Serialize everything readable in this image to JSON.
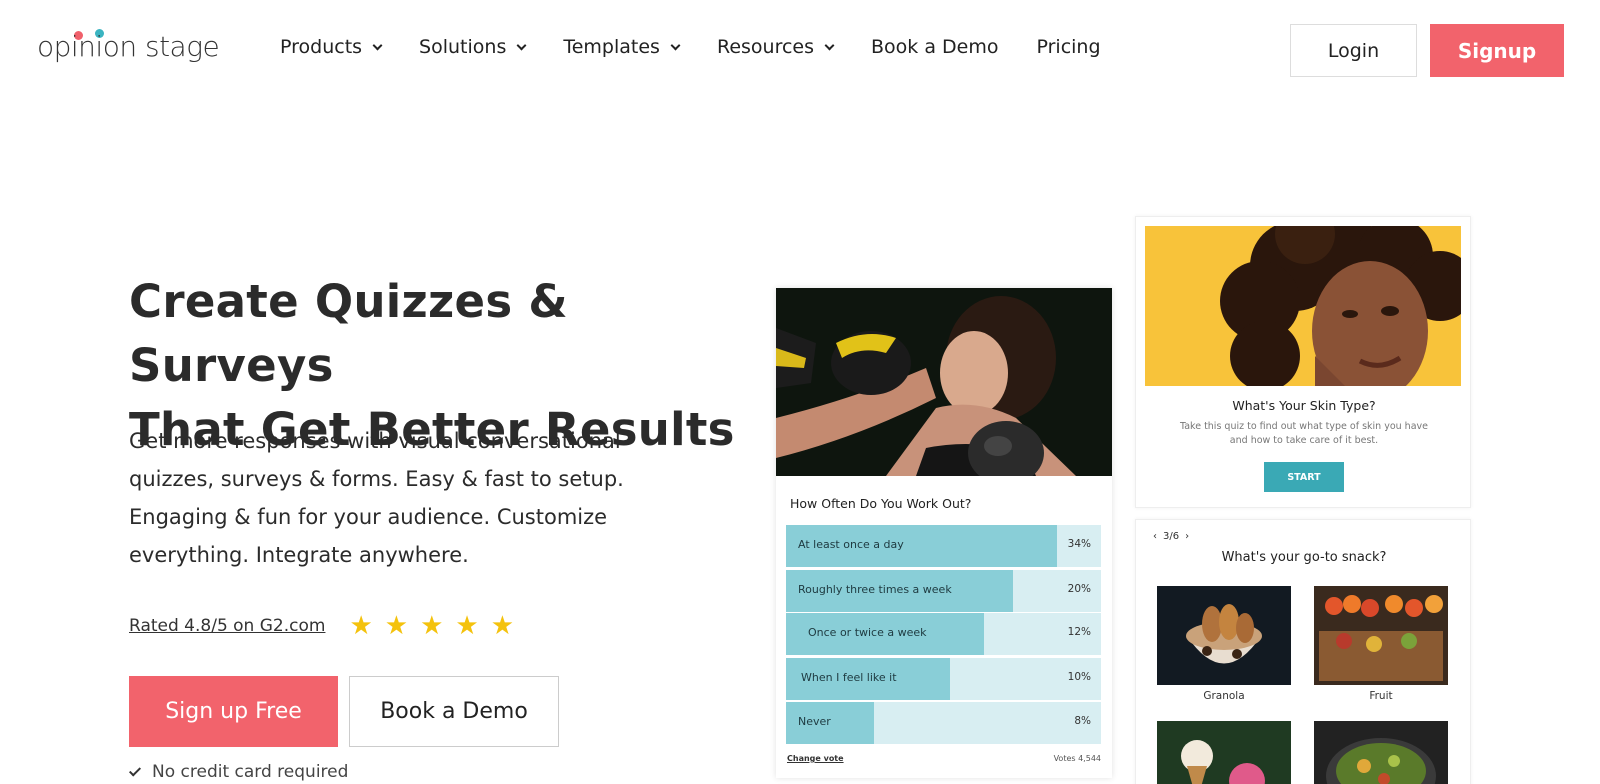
{
  "brand": {
    "logo_text": "opinion stage"
  },
  "nav": {
    "items": [
      {
        "label": "Products",
        "dropdown": true
      },
      {
        "label": "Solutions",
        "dropdown": true
      },
      {
        "label": "Templates",
        "dropdown": true
      },
      {
        "label": "Resources",
        "dropdown": true
      },
      {
        "label": "Book a Demo",
        "dropdown": false
      },
      {
        "label": "Pricing",
        "dropdown": false
      }
    ],
    "login_label": "Login",
    "signup_label": "Signup"
  },
  "hero": {
    "title_line1": "Create Quizzes & Surveys",
    "title_line2": "That Get Better Results",
    "subtitle": "Get more responses with visual conversational quizzes, surveys & forms. Easy & fast to setup. Engaging & fun for your audience. Customize everything. Integrate anywhere.",
    "rating_text": "Rated 4.8/5 on G2.com",
    "stars": 5,
    "cta_primary": "Sign up Free",
    "cta_secondary": "Book a Demo",
    "no_credit_card": "No credit card required"
  },
  "poll": {
    "question": "How Often Do You Work Out?",
    "options": [
      {
        "label": "At least once a day",
        "pct": "34%",
        "fill_fraction": 0.86
      },
      {
        "label": "Roughly three times a week",
        "pct": "20%",
        "fill_fraction": 0.72
      },
      {
        "label": "Once or twice a week",
        "pct": "12%",
        "fill_fraction": 0.63
      },
      {
        "label": "When I feel like it",
        "pct": "10%",
        "fill_fraction": 0.52
      },
      {
        "label": "Never",
        "pct": "8%",
        "fill_fraction": 0.28
      }
    ],
    "change_vote": "Change vote",
    "votes": "Votes 4,544"
  },
  "skin_quiz": {
    "title": "What's Your Skin Type?",
    "description": "Take this quiz to find out what type of skin you have and how to take care of it best.",
    "start_label": "START"
  },
  "snack": {
    "pager": "3/6",
    "question": "What's your go-to snack?",
    "options": [
      "Granola",
      "Fruit"
    ]
  },
  "colors": {
    "brand_red": "#f2636c",
    "teal": "#3aa9b5",
    "poll_fill": "#89ced7",
    "star": "#f4c20d"
  }
}
